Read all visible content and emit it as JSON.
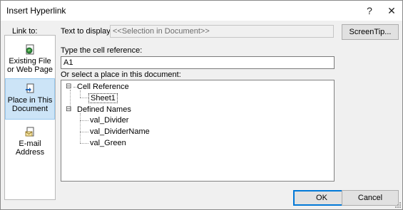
{
  "window": {
    "title": "Insert Hyperlink",
    "help_glyph": "?",
    "close_glyph": "✕"
  },
  "link_to": {
    "label": "Link to:",
    "items": [
      {
        "label_line1": "Existing File",
        "label_line2": "or Web Page",
        "icon": "globe-file-icon"
      },
      {
        "label_line1": "Place in This",
        "label_line2": "Document",
        "icon": "document-place-icon"
      },
      {
        "label_line1": "E-mail",
        "label_line2": "Address",
        "icon": "email-icon"
      }
    ],
    "selected_index": 1
  },
  "display": {
    "label": "Text to display:",
    "value": "<<Selection in Document>>"
  },
  "screentip_button": "ScreenTip...",
  "cell_reference": {
    "label": "Type the cell reference:",
    "value": "A1"
  },
  "place": {
    "label": "Or select a place in this document:",
    "tree": {
      "group1": {
        "label": "Cell Reference",
        "expander": "⊟",
        "children": [
          "Sheet1"
        ]
      },
      "group2": {
        "label": "Defined Names",
        "expander": "⊟",
        "children": [
          "val_Divider",
          "val_DividerName",
          "val_Green"
        ]
      }
    }
  },
  "buttons": {
    "ok": "OK",
    "cancel": "Cancel"
  },
  "colors": {
    "selection": "#cce4f7",
    "default_button_border": "#0078d7"
  }
}
